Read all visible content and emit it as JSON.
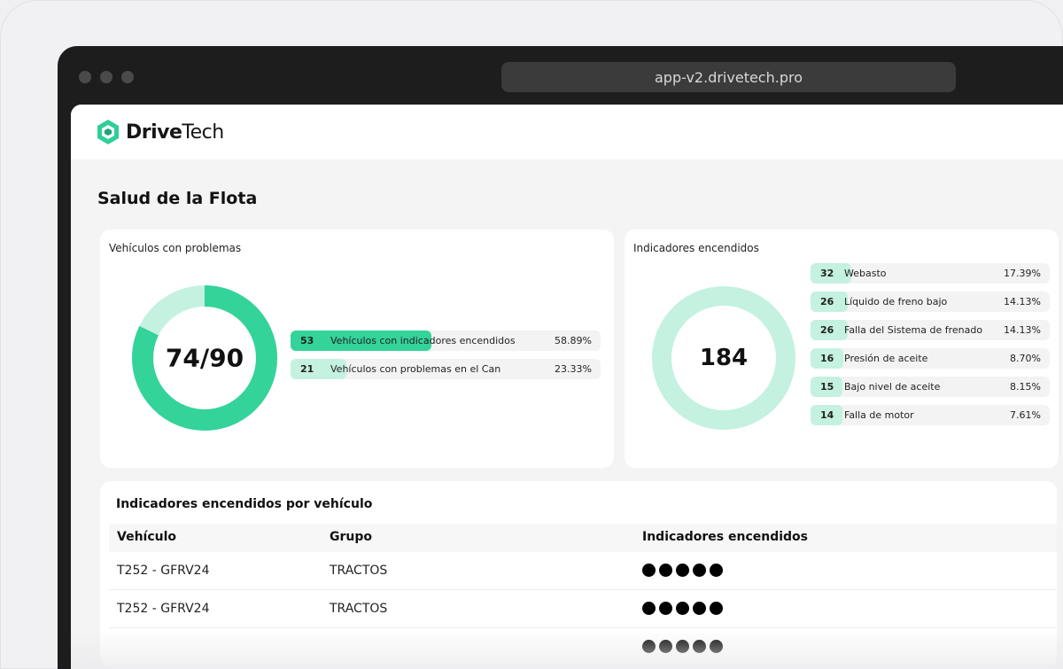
{
  "browser": {
    "url": "app-v2.drivetech.pro"
  },
  "brand": {
    "name_bold": "Drive",
    "name_light": "Tech",
    "accent": "#34d399",
    "light": "#c4f1e0"
  },
  "page": {
    "title": "Salud de la Flota"
  },
  "vehicles_card": {
    "title": "Vehículos con problemas",
    "donut_label": "74/90",
    "affected": 74,
    "total": 90,
    "rows": [
      {
        "count": "53",
        "label": "Vehículos con indicadores encendidos",
        "percent": "58.89%",
        "value": 58.89
      },
      {
        "count": "21",
        "label": "Vehículos con problemas en el Can",
        "percent": "23.33%",
        "value": 23.33
      }
    ]
  },
  "indicators_card": {
    "title": "Indicadores encendidos",
    "donut_label": "184",
    "rows": [
      {
        "count": "32",
        "label": "Webasto",
        "percent": "17.39%",
        "value": 32
      },
      {
        "count": "26",
        "label": "Líquido de freno bajo",
        "percent": "14.13%",
        "value": 26
      },
      {
        "count": "26",
        "label": "Falla del Sistema de frenado",
        "percent": "14.13%",
        "value": 26
      },
      {
        "count": "16",
        "label": "Presión de aceite",
        "percent": "8.70%",
        "value": 16
      },
      {
        "count": "15",
        "label": "Bajo nivel de aceite",
        "percent": "8.15%",
        "value": 15
      },
      {
        "count": "14",
        "label": "Falla de motor",
        "percent": "7.61%",
        "value": 14
      }
    ]
  },
  "table": {
    "title": "Indicadores encendidos por vehículo",
    "columns": [
      "Vehículo",
      "Grupo",
      "Indicadores encendidos"
    ],
    "rows": [
      {
        "vehicle": "T252 - GFRV24",
        "group": "TRACTOS",
        "indicators": 5
      },
      {
        "vehicle": "T252 - GFRV24",
        "group": "TRACTOS",
        "indicators": 5
      },
      {
        "vehicle": "",
        "group": "",
        "indicators": 5
      }
    ]
  }
}
